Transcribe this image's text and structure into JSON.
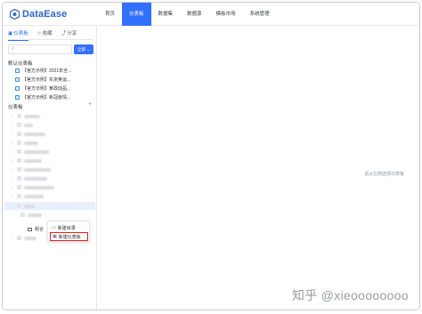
{
  "app": {
    "logo_text": "DataEase"
  },
  "nav": {
    "items": [
      {
        "label": "首页",
        "active": false
      },
      {
        "label": "仪表板",
        "active": true
      },
      {
        "label": "数据集",
        "active": false
      },
      {
        "label": "数据源",
        "active": false
      },
      {
        "label": "模板市场",
        "active": false
      },
      {
        "label": "系统管理",
        "active": false
      }
    ]
  },
  "sidebar": {
    "tabs": [
      {
        "icon": "dashboard-icon",
        "label": "仪表板",
        "active": true
      },
      {
        "icon": "star-icon",
        "label": "收藏",
        "active": false
      },
      {
        "icon": "share-icon",
        "label": "分享",
        "active": false
      }
    ],
    "search": {
      "placeholder": ""
    },
    "filter_button_label": "全部",
    "default_section_title": "默认仪表板",
    "default_items": [
      {
        "label": "【官方示例】2021年全..."
      },
      {
        "label": "【官方示例】东京奥运..."
      },
      {
        "label": "【官方示例】某政动品..."
      },
      {
        "label": "【官方示例】新冠疫情..."
      }
    ],
    "dashboards_section_title": "仪表板",
    "combo_label": "组合"
  },
  "context_menu": {
    "items": [
      {
        "label": "新建目录",
        "icon": "folder-icon",
        "highlighted": false
      },
      {
        "label": "新建仪表板",
        "icon": "dashboard-add-icon",
        "highlighted": true
      }
    ]
  },
  "main": {
    "empty_tip": "请从左侧选择仪表板"
  },
  "watermark": "知乎 @xieoooooooo",
  "colors": {
    "accent": "#3370ff",
    "highlight": "#e02020"
  }
}
